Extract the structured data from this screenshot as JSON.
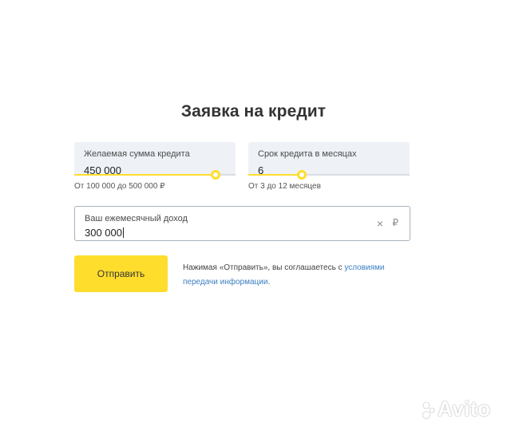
{
  "form": {
    "title": "Заявка на кредит",
    "amount": {
      "label": "Желаемая сумма кредита",
      "value": "450 000",
      "hint": "От 100 000 до 500 000 ₽",
      "slider_fraction": 0.875
    },
    "term": {
      "label": "Срок кредита в месяцах",
      "value": "6",
      "hint": "От 3 до 12 месяцев",
      "slider_fraction": 0.333
    },
    "income": {
      "label": "Ваш ежемесячный доход",
      "value": "300 000",
      "clear_icon": "×",
      "currency": "₽"
    },
    "submit_label": "Отправить",
    "consent": {
      "text": "Нажимая «Отправить», вы соглашаетесь с",
      "link_text": "условиями передачи информации",
      "end": "."
    }
  },
  "watermark": {
    "text": "Avito"
  },
  "colors": {
    "accent": "#ffdd2d",
    "field_bg": "#eef2f7",
    "link": "#3a7fc1"
  }
}
